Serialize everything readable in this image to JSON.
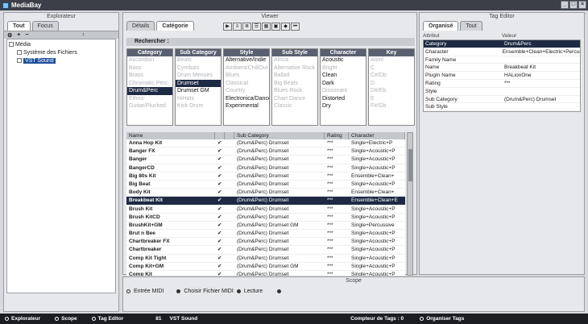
{
  "window": {
    "title": "MediaBay"
  },
  "explorer": {
    "title": "Explorateur",
    "tabs": [
      {
        "label": "Tout",
        "active": true
      },
      {
        "label": "Focus",
        "active": false
      }
    ],
    "tree": [
      {
        "label": "Média",
        "level": 0
      },
      {
        "label": "Système des Fichiers",
        "level": 1
      },
      {
        "label": "VST Sound",
        "level": 1,
        "selected": true
      }
    ]
  },
  "viewer": {
    "title": "Viewer",
    "tabs": [
      {
        "label": "Détails"
      },
      {
        "label": "Catégorie",
        "active": true
      }
    ],
    "search_label": "Rechercher :",
    "filters": [
      {
        "header": "Category",
        "items": [
          {
            "t": "Accordion"
          },
          {
            "t": "Bass"
          },
          {
            "t": "Brass"
          },
          {
            "t": "Chromatic Perc"
          },
          {
            "t": "Drum&Perc",
            "s": true
          },
          {
            "t": "Ethnic"
          },
          {
            "t": "Guitar/Plucked"
          }
        ]
      },
      {
        "header": "Sub Category",
        "items": [
          {
            "t": "Beats"
          },
          {
            "t": "Cymbals"
          },
          {
            "t": "Drum Menues"
          },
          {
            "t": "Drumset",
            "s": true
          },
          {
            "t": "Drumset GM",
            "b": true
          },
          {
            "t": "HiHats"
          },
          {
            "t": "Kick Drum"
          }
        ]
      },
      {
        "header": "Style",
        "items": [
          {
            "t": "Alternative/Indie",
            "b": true
          },
          {
            "t": "Ambient/ChillOut"
          },
          {
            "t": "Blues"
          },
          {
            "t": "Classical"
          },
          {
            "t": "Country"
          },
          {
            "t": "Electronica/Dance",
            "b": true
          },
          {
            "t": "Experimental",
            "b": true
          }
        ]
      },
      {
        "header": "Sub Style",
        "items": [
          {
            "t": "Africa"
          },
          {
            "t": "Alternative Rock"
          },
          {
            "t": "Ballad"
          },
          {
            "t": "Big Beats"
          },
          {
            "t": "Blues Rock"
          },
          {
            "t": "Chart Dance"
          },
          {
            "t": "Classic"
          }
        ]
      },
      {
        "header": "Character",
        "items": [
          {
            "t": "Acoustic",
            "b": true
          },
          {
            "t": "Bright"
          },
          {
            "t": "Clean",
            "b": true
          },
          {
            "t": "Dark",
            "b": true
          },
          {
            "t": "Dissonant"
          },
          {
            "t": "Distorted",
            "b": true
          },
          {
            "t": "Dry",
            "b": true
          }
        ]
      },
      {
        "header": "Key",
        "items": [
          {
            "t": "Atonl"
          },
          {
            "t": "C"
          },
          {
            "t": "C#/Db"
          },
          {
            "t": "D"
          },
          {
            "t": "D#/Eb"
          },
          {
            "t": "E"
          },
          {
            "t": "F#/Gb"
          }
        ]
      }
    ],
    "columns": [
      "Name",
      "",
      "",
      "Sub Category",
      "Rating",
      "Character"
    ],
    "results": [
      {
        "name": "Anna Hop Kit",
        "sub": "(Drum&Perc) Drumset",
        "rating": "***",
        "char": "Single+Electric+P"
      },
      {
        "name": "Banger FX",
        "sub": "(Drum&Perc) Drumset",
        "rating": "***",
        "char": "Single+Acoustic+P"
      },
      {
        "name": "Banger",
        "sub": "(Drum&Perc) Drumset",
        "rating": "***",
        "char": "Single+Acoustic+P"
      },
      {
        "name": "BangerCD",
        "sub": "(Drum&Perc) Drumset",
        "rating": "***",
        "char": "Single+Acoustic+P"
      },
      {
        "name": "Big 80s Kit",
        "sub": "(Drum&Perc) Drumset",
        "rating": "***",
        "char": "Ensemble+Clean+"
      },
      {
        "name": "Big Beat",
        "sub": "(Drum&Perc) Drumset",
        "rating": "***",
        "char": "Single+Acoustic+P"
      },
      {
        "name": "Body Kit",
        "sub": "(Drum&Perc) Drumset",
        "rating": "***",
        "char": "Ensemble+Clean+"
      },
      {
        "name": "Breakbeat Kit",
        "sub": "(Drum&Perc) Drumset",
        "rating": "***",
        "char": "Ensemble+Clean+E",
        "sel": true
      },
      {
        "name": "Brush Kit",
        "sub": "(Drum&Perc) Drumset",
        "rating": "***",
        "char": "Single+Acoustic+P"
      },
      {
        "name": "Brush KitCD",
        "sub": "(Drum&Perc) Drumset",
        "rating": "***",
        "char": "Single+Acoustic+P"
      },
      {
        "name": "BrushKit+GM",
        "sub": "(Drum&Perc) Drumset GM",
        "rating": "***",
        "char": "Single+Percussive"
      },
      {
        "name": "Brut n Bee",
        "sub": "(Drum&Perc) Drumset",
        "rating": "***",
        "char": "Single+Acoustic+P"
      },
      {
        "name": "Chartbreaker FX",
        "sub": "(Drum&Perc) Drumset",
        "rating": "***",
        "char": "Single+Acoustic+P"
      },
      {
        "name": "Chartbreaker",
        "sub": "(Drum&Perc) Drumset",
        "rating": "***",
        "char": "Single+Acoustic+P"
      },
      {
        "name": "Comp Kit Tight",
        "sub": "(Drum&Perc) Drumset",
        "rating": "***",
        "char": "Single+Acoustic+P"
      },
      {
        "name": "Comp Kit+GM",
        "sub": "(Drum&Perc) Drumset GM",
        "rating": "***",
        "char": "Single+Acoustic+P"
      },
      {
        "name": "Comp Kit",
        "sub": "(Drum&Perc) Drumset",
        "rating": "***",
        "char": "Single+Acoustic+P"
      }
    ]
  },
  "tag_editor": {
    "title": "Tag Editor",
    "tabs": [
      {
        "label": "Organisé",
        "active": true
      },
      {
        "label": "Tout"
      }
    ],
    "header": [
      "Attribut",
      "Valeur"
    ],
    "rows": [
      {
        "k": "Category",
        "v": "Drum&Perc",
        "sel": true
      },
      {
        "k": "Character",
        "v": "Ensemble+Clean+Electric+Percus"
      },
      {
        "k": "Family Name",
        "v": ""
      },
      {
        "k": "Name",
        "v": "Breakbeat Kit"
      },
      {
        "k": "PlugIn Name",
        "v": "HALionOne"
      },
      {
        "k": "Rating",
        "v": "***"
      },
      {
        "k": "Style",
        "v": ""
      },
      {
        "k": "Sub Category",
        "v": "(Drum&Perc) Drumset"
      },
      {
        "k": "Sub Style",
        "v": ""
      }
    ]
  },
  "scope": {
    "title": "Scope",
    "midi_label": "Entrée MIDI",
    "choose_label": "Choisir Fichier MIDI",
    "play_label": "Lecture"
  },
  "status": {
    "explorer": "Explorateur",
    "scope": "Scope",
    "tag_editor": "Tag Editor",
    "count": "81",
    "path": "VST Sound",
    "tag_count": "Compteur de Tags : 0",
    "organize": "Organiser Tags"
  }
}
